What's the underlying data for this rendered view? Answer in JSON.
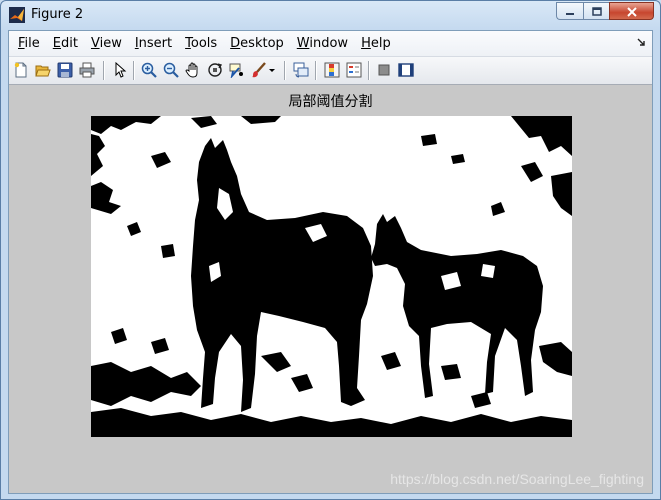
{
  "window": {
    "title": "Figure 2"
  },
  "menu": {
    "items": [
      {
        "label": "File",
        "mnemonic": "F",
        "rest": "ile"
      },
      {
        "label": "Edit",
        "mnemonic": "E",
        "rest": "dit"
      },
      {
        "label": "View",
        "mnemonic": "V",
        "rest": "iew"
      },
      {
        "label": "Insert",
        "mnemonic": "I",
        "rest": "nsert"
      },
      {
        "label": "Tools",
        "mnemonic": "T",
        "rest": "ools"
      },
      {
        "label": "Desktop",
        "mnemonic": "D",
        "rest": "esktop"
      },
      {
        "label": "Window",
        "mnemonic": "W",
        "rest": "indow"
      },
      {
        "label": "Help",
        "mnemonic": "H",
        "rest": "elp"
      }
    ],
    "dock_icon": "dock-arrow-icon"
  },
  "toolbar": {
    "buttons": [
      "new-figure-icon",
      "open-file-icon",
      "save-figure-icon",
      "print-figure-icon",
      "edit-plot-icon",
      "zoom-in-icon",
      "zoom-out-icon",
      "pan-icon",
      "rotate-3d-icon",
      "data-cursor-icon",
      "brush-icon",
      "brush-dropdown-icon",
      "link-plot-icon",
      "insert-colorbar-icon",
      "insert-legend-icon",
      "hide-plot-tools-icon",
      "show-plot-tools-icon"
    ]
  },
  "figure": {
    "axes_title": "局部阈值分割",
    "image_description_name": "thresholded-horses-image"
  },
  "watermark": "https://blog.csdn.net/SoaringLee_fighting",
  "colors": {
    "figure_background": "#c8c8c8",
    "image_foreground": "#000000",
    "image_background": "#ffffff",
    "close_button": "#c7462f"
  }
}
